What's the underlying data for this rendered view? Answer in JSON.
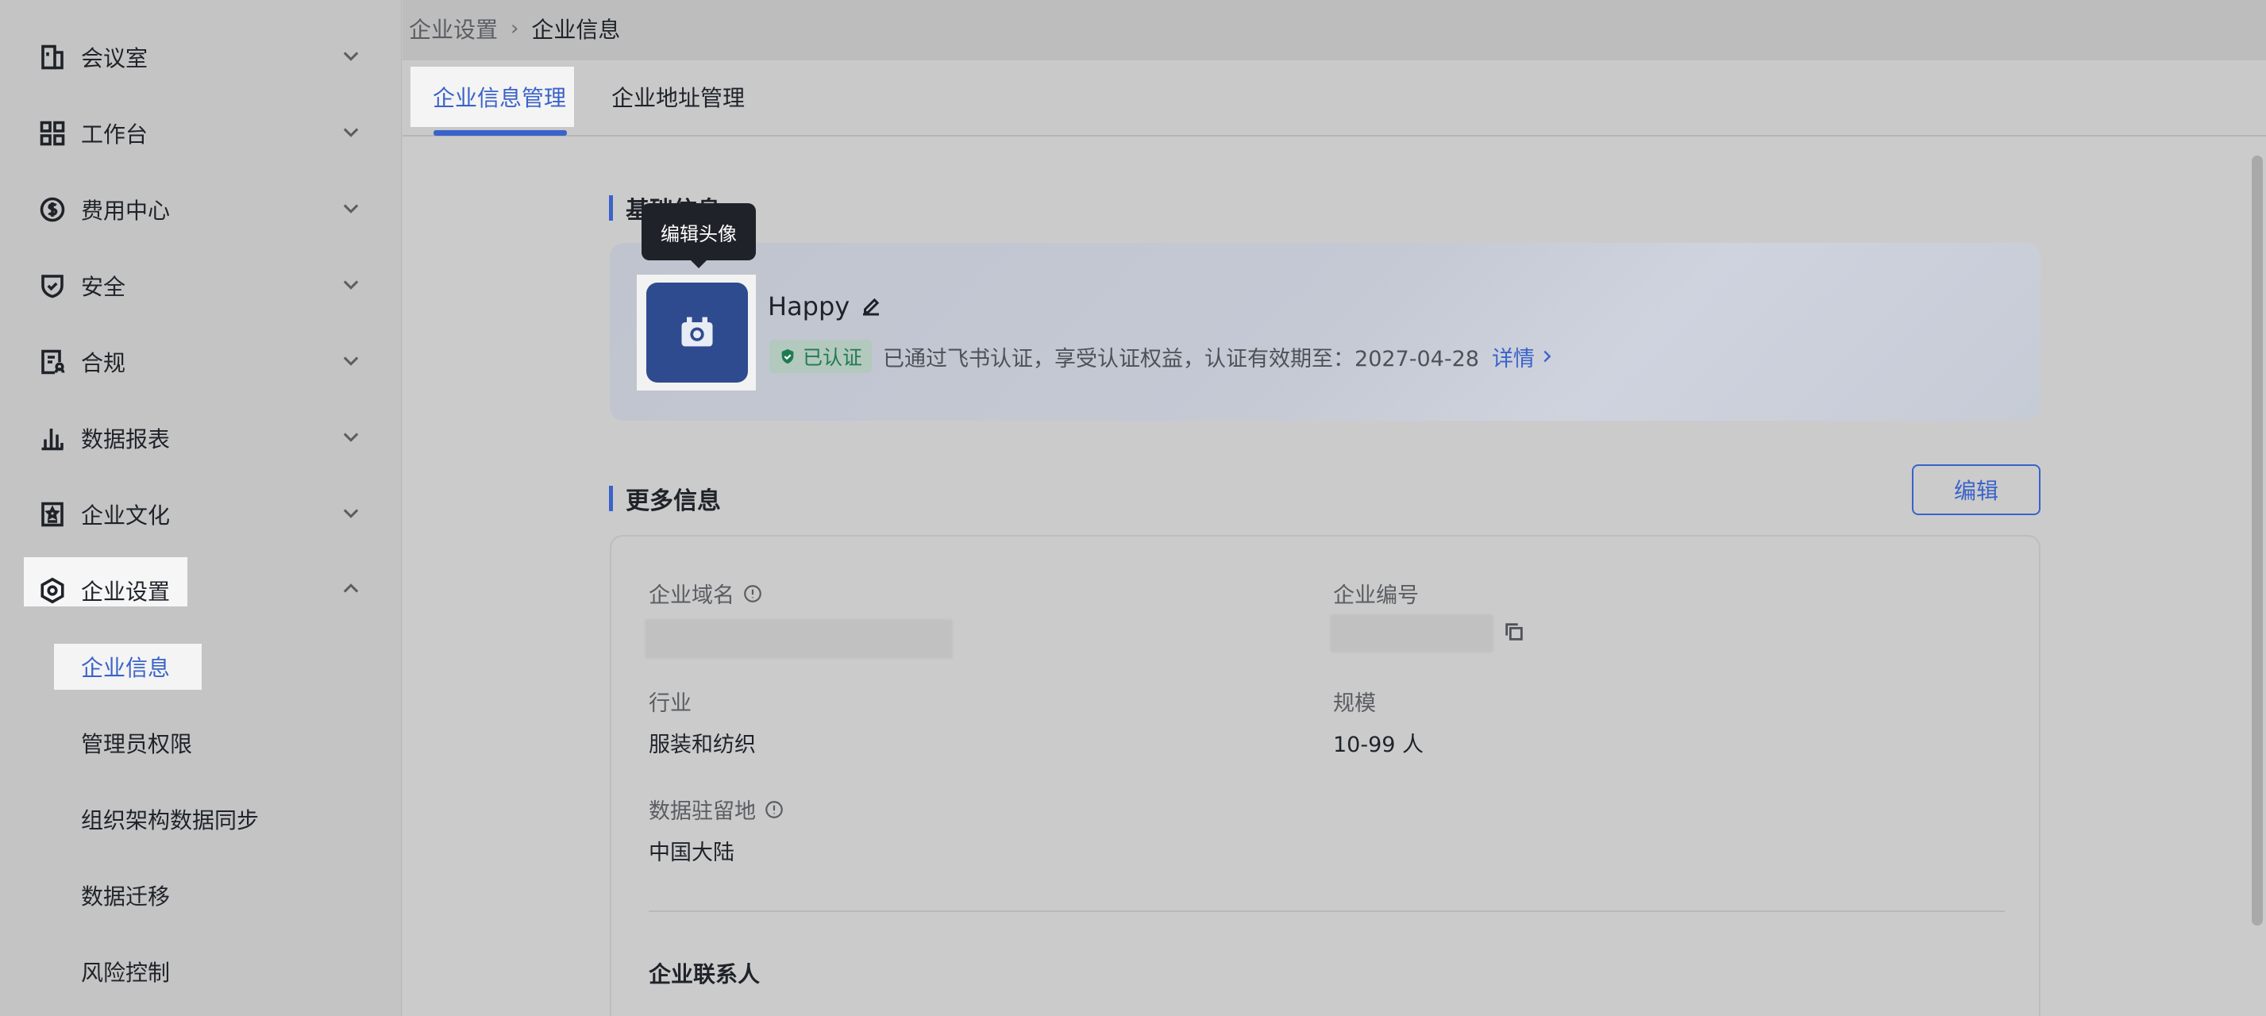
{
  "sidebar": {
    "items": [
      {
        "label": "会议室",
        "icon": "building-icon"
      },
      {
        "label": "工作台",
        "icon": "grid-icon"
      },
      {
        "label": "费用中心",
        "icon": "dollar-circle-icon"
      },
      {
        "label": "安全",
        "icon": "shield-icon"
      },
      {
        "label": "合规",
        "icon": "compliance-icon"
      },
      {
        "label": "数据报表",
        "icon": "bar-chart-icon"
      },
      {
        "label": "企业文化",
        "icon": "culture-icon"
      },
      {
        "label": "企业设置",
        "icon": "settings-hex-icon"
      }
    ],
    "sub_items": [
      "企业信息",
      "管理员权限",
      "组织架构数据同步",
      "数据迁移",
      "风险控制"
    ]
  },
  "breadcrumb": {
    "parent": "企业设置",
    "current": "企业信息"
  },
  "tabs": [
    {
      "label": "企业信息管理"
    },
    {
      "label": "企业地址管理"
    }
  ],
  "basic": {
    "title": "基础信息",
    "tooltip": "编辑头像",
    "company_name": "Happy",
    "badge": "已认证",
    "cert_text": "已通过飞书认证，享受认证权益，认证有效期至：2027-04-28",
    "detail_link": "详情"
  },
  "more": {
    "title": "更多信息",
    "edit_label": "编辑",
    "domain_label": "企业域名",
    "id_label": "企业编号",
    "industry_label": "行业",
    "industry_value": "服装和纺织",
    "scale_label": "规模",
    "scale_value": "10-99 人",
    "residency_label": "数据驻留地",
    "residency_value": "中国大陆",
    "contact_title": "企业联系人"
  },
  "colors": {
    "accent": "#3a63c9",
    "verified": "#1f7a52"
  }
}
